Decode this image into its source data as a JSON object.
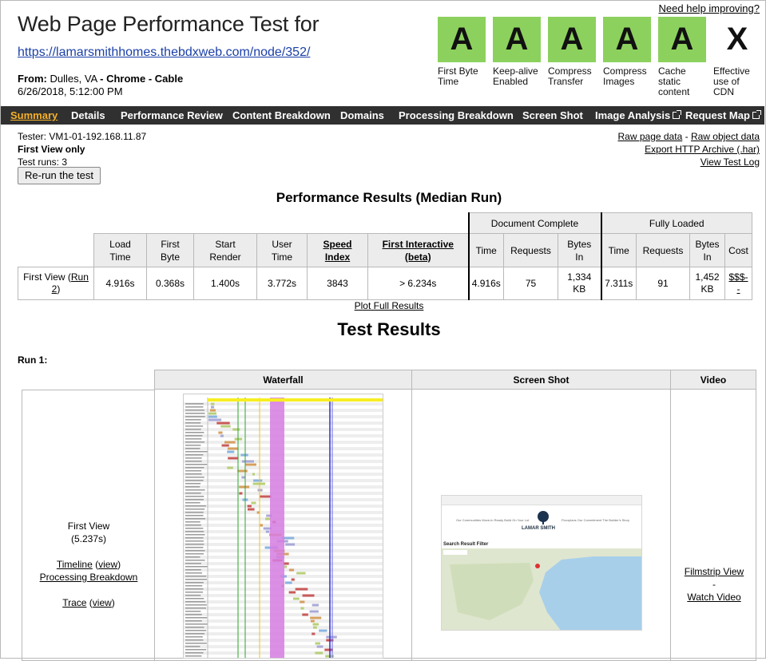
{
  "header": {
    "help_link": "Need help improving?",
    "title": "Web Page Performance Test for",
    "url": "https://lamarsmithhomes.thebdxweb.com/node/352/",
    "from_label": "From:",
    "location": "Dulles, VA",
    "sep": "-",
    "browser": "Chrome",
    "connection": "Cable",
    "datetime": "6/26/2018, 5:12:00 PM"
  },
  "grades": [
    {
      "grade": "A",
      "label1": "First Byte",
      "label2": "Time",
      "label3": ""
    },
    {
      "grade": "A",
      "label1": "Keep-alive",
      "label2": "Enabled",
      "label3": ""
    },
    {
      "grade": "A",
      "label1": "Compress",
      "label2": "Transfer",
      "label3": ""
    },
    {
      "grade": "A",
      "label1": "Compress",
      "label2": "Images",
      "label3": ""
    },
    {
      "grade": "A",
      "label1": "Cache",
      "label2": "static",
      "label3": "content"
    },
    {
      "grade": "X",
      "label1": "Effective",
      "label2": "use of CDN",
      "label3": ""
    }
  ],
  "nav": {
    "summary": "Summary",
    "details": "Details",
    "performance_review": "Performance Review",
    "content_breakdown": "Content Breakdown",
    "domains": "Domains",
    "processing_breakdown": "Processing Breakdown",
    "screen_shot": "Screen Shot",
    "image_analysis": "Image Analysis",
    "request_map": "Request Map"
  },
  "info": {
    "tester": "Tester: VM1-01-192.168.11.87",
    "first_view_only": "First View only",
    "test_runs": "Test runs: 3",
    "rerun": "Re-run the test",
    "raw_page_data": "Raw page data",
    "dash": "-",
    "raw_object_data": "Raw object data",
    "export_har": "Export HTTP Archive (.har)",
    "view_test_log": "View Test Log"
  },
  "performance": {
    "title": "Performance Results (Median Run)",
    "group_doc": "Document Complete",
    "group_full": "Fully Loaded",
    "cols": {
      "load_time": [
        "Load",
        "Time"
      ],
      "first_byte": [
        "First",
        "Byte"
      ],
      "start_render": [
        "Start",
        "Render"
      ],
      "user_time": [
        "User",
        "Time"
      ],
      "speed_index": [
        "Speed",
        "Index"
      ],
      "first_interactive": [
        "First Interactive",
        "(beta)"
      ],
      "time": "Time",
      "requests": "Requests",
      "bytes_in": [
        "Bytes",
        "In"
      ],
      "cost": "Cost"
    },
    "row": {
      "label": "First View (",
      "run_link": "Run",
      "run_num": "2",
      "close": ")",
      "load_time": "4.916s",
      "first_byte": "0.368s",
      "start_render": "1.400s",
      "user_time": "3.772s",
      "speed_index": "3843",
      "first_interactive": "> 6.234s",
      "doc_time": "4.916s",
      "doc_requests": "75",
      "doc_bytes": "1,334",
      "doc_bytes_unit": "KB",
      "full_time": "7.311s",
      "full_requests": "91",
      "full_bytes": "1,452",
      "full_bytes_unit": "KB",
      "cost1": "$$$-",
      "cost2": "-"
    },
    "plot_full": "Plot Full Results"
  },
  "test_results": {
    "title": "Test Results",
    "run_label": "Run 1:",
    "cols": {
      "waterfall": "Waterfall",
      "screen_shot": "Screen Shot",
      "video": "Video"
    },
    "first_view": "First View",
    "first_view_time": "(5.237s)",
    "timeline": "Timeline",
    "view": "view",
    "processing_breakdown": "Processing Breakdown",
    "trace": "Trace",
    "filmstrip": "Filmstrip View",
    "dash": "-",
    "watch_video": "Watch Video"
  },
  "screenshot_thumb": {
    "menu_left": "Our Communities   Move-in Ready   Build On Your Lot",
    "menu_right": "Floorplans   Our Commitment   The Builder's Story",
    "brand": "LAMAR SMITH",
    "filter": "Search Result Filter"
  },
  "colors": {
    "grade_green": "#8cd15d",
    "nav_bg": "#303030",
    "nav_active": "#f7b128",
    "url_blue": "#1a3fa8",
    "header_gray": "#ececec"
  }
}
